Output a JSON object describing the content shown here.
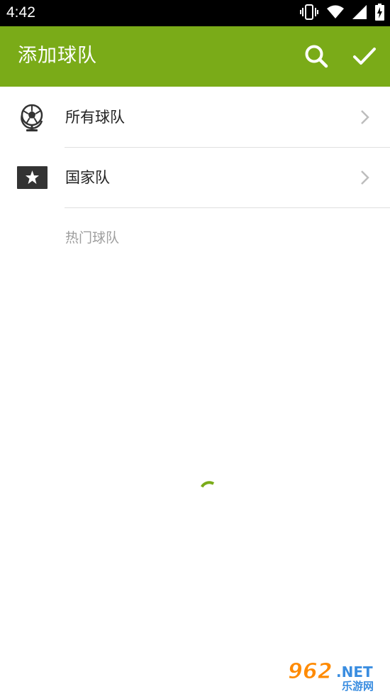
{
  "status_bar": {
    "time": "4:42",
    "icons": [
      "vibrate-icon",
      "wifi-icon",
      "signal-icon",
      "battery-charging-icon"
    ]
  },
  "app_bar": {
    "title": "添加球队",
    "actions": [
      "search-icon",
      "check-icon"
    ],
    "color": "#7aab18"
  },
  "list": {
    "items": [
      {
        "label": "所有球队",
        "icon": "soccer-globe-icon"
      },
      {
        "label": "国家队",
        "icon": "star-flag-icon"
      }
    ],
    "section_header": "热门球队"
  },
  "loading": {
    "indicator": "spinner",
    "color": "#7aab18"
  },
  "watermark": {
    "text": "962.NET",
    "subtext": "乐游网"
  }
}
